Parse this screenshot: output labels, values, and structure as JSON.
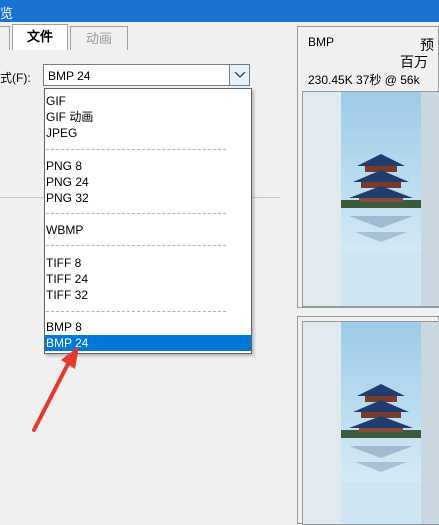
{
  "window": {
    "title_fragment": "览"
  },
  "tabs": [
    {
      "label": "文件",
      "state": "active"
    },
    {
      "label": "动画",
      "state": "disabled"
    }
  ],
  "format": {
    "label_fragment": "式(F):",
    "selected_value": "BMP 24"
  },
  "dropdown": {
    "items": [
      "GIF",
      "GIF 动画",
      "JPEG",
      "PNG 8",
      "PNG 24",
      "PNG 32",
      "WBMP",
      "TIFF 8",
      "TIFF 24",
      "TIFF 32",
      "BMP 8",
      "BMP 24"
    ],
    "selected": "BMP 24"
  },
  "preview_top": {
    "format": "BMP",
    "title_fragment": "预",
    "subtitle_fragment": "百万",
    "info": "230.45K  37秒 @ 56k"
  },
  "colors": {
    "titlebar": "#1a73d1",
    "selection": "#0078d7",
    "arrow": "#e8372c",
    "sky": "#8ec6e6",
    "water": "#cfe6f2"
  }
}
